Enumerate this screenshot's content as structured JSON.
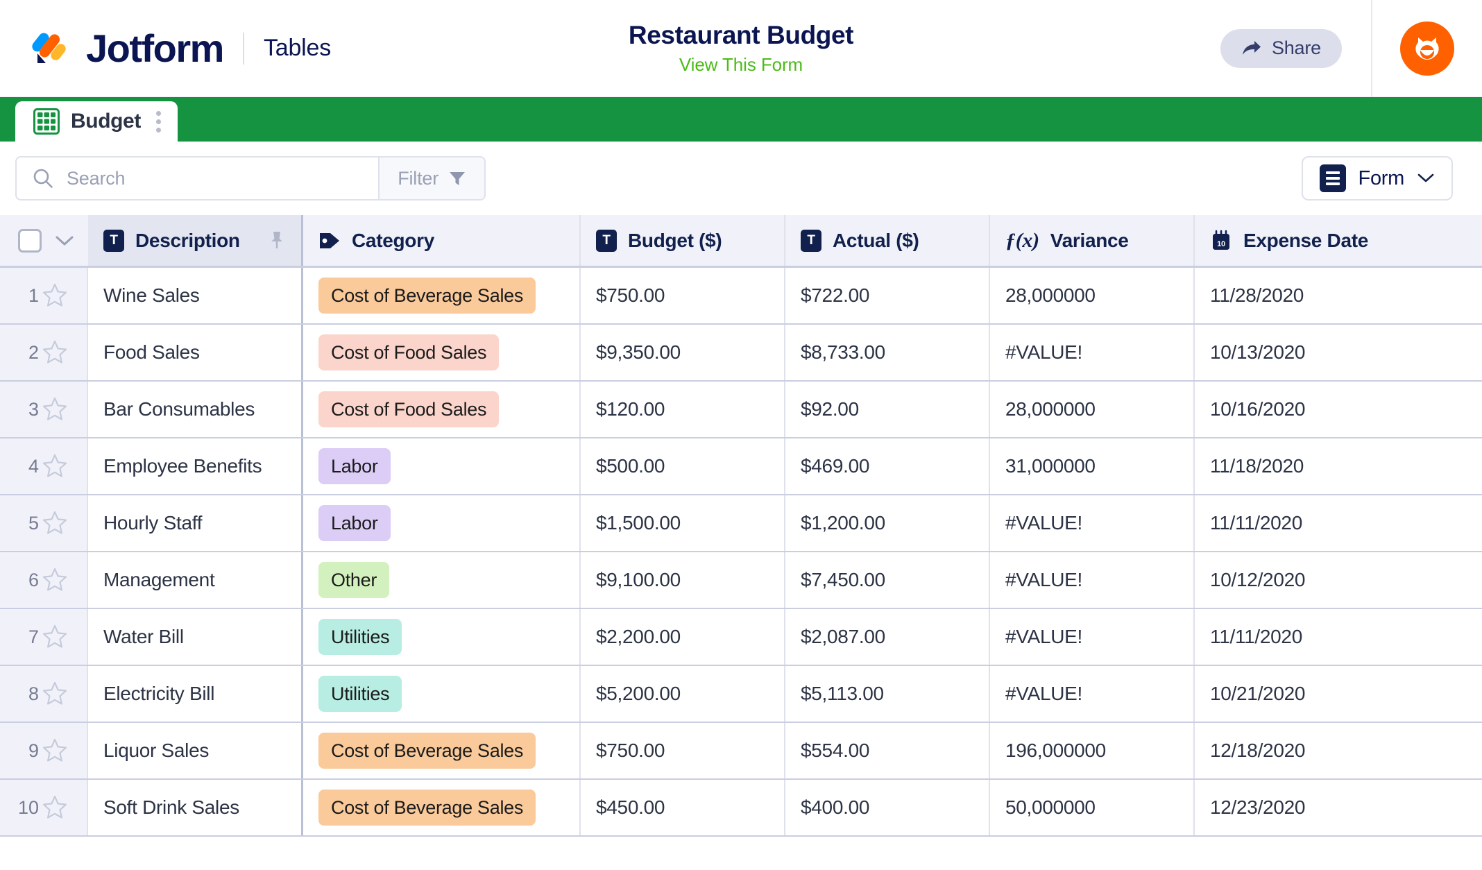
{
  "header": {
    "brand_name": "Jotform",
    "product_label": "Tables",
    "form_title": "Restaurant Budget",
    "view_form_link": "View This Form",
    "share_label": "Share",
    "brand_navy": "#0A1551",
    "link_green": "#4CBB17",
    "avatar_color": "#FF6100"
  },
  "tabs": {
    "active_tab_label": "Budget",
    "strip_color": "#159340"
  },
  "toolbar": {
    "search_placeholder": "Search",
    "search_value": "",
    "filter_label": "Filter",
    "view_label": "Form"
  },
  "table": {
    "columns": [
      {
        "label": "Description",
        "icon": "text-field-icon",
        "pinned": true
      },
      {
        "label": "Category",
        "icon": "tag-icon",
        "pinned": false
      },
      {
        "label": "Budget ($)",
        "icon": "text-field-icon",
        "pinned": false
      },
      {
        "label": "Actual ($)",
        "icon": "text-field-icon",
        "pinned": false
      },
      {
        "label": "Variance",
        "icon": "formula-icon",
        "pinned": false
      },
      {
        "label": "Expense Date",
        "icon": "calendar-icon",
        "pinned": false
      }
    ],
    "calendar_icon_day": "10",
    "category_colors": {
      "Cost of Beverage Sales": "#FACA9A",
      "Cost of Food Sales": "#FBD5CB",
      "Labor": "#DCCDF7",
      "Other": "#D3F1BE",
      "Utilities": "#B7EDE2"
    },
    "rows": [
      {
        "num": "1",
        "description": "Wine Sales",
        "category": "Cost of Beverage Sales",
        "budget": "$750.00",
        "actual": "$722.00",
        "variance": "28,000000",
        "date": "11/28/2020"
      },
      {
        "num": "2",
        "description": "Food Sales",
        "category": "Cost of Food Sales",
        "budget": "$9,350.00",
        "actual": "$8,733.00",
        "variance": "#VALUE!",
        "date": "10/13/2020"
      },
      {
        "num": "3",
        "description": "Bar Consumables",
        "category": "Cost of Food Sales",
        "budget": "$120.00",
        "actual": "$92.00",
        "variance": "28,000000",
        "date": "10/16/2020"
      },
      {
        "num": "4",
        "description": "Employee Benefits",
        "category": "Labor",
        "budget": "$500.00",
        "actual": "$469.00",
        "variance": "31,000000",
        "date": "11/18/2020"
      },
      {
        "num": "5",
        "description": "Hourly Staff",
        "category": "Labor",
        "budget": "$1,500.00",
        "actual": "$1,200.00",
        "variance": "#VALUE!",
        "date": "11/11/2020"
      },
      {
        "num": "6",
        "description": "Management",
        "category": "Other",
        "budget": "$9,100.00",
        "actual": "$7,450.00",
        "variance": "#VALUE!",
        "date": "10/12/2020"
      },
      {
        "num": "7",
        "description": "Water Bill",
        "category": "Utilities",
        "budget": "$2,200.00",
        "actual": "$2,087.00",
        "variance": "#VALUE!",
        "date": "11/11/2020"
      },
      {
        "num": "8",
        "description": "Electricity Bill",
        "category": "Utilities",
        "budget": "$5,200.00",
        "actual": "$5,113.00",
        "variance": "#VALUE!",
        "date": "10/21/2020"
      },
      {
        "num": "9",
        "description": "Liquor Sales",
        "category": "Cost of Beverage Sales",
        "budget": "$750.00",
        "actual": "$554.00",
        "variance": "196,000000",
        "date": "12/18/2020"
      },
      {
        "num": "10",
        "description": "Soft Drink Sales",
        "category": "Cost of Beverage Sales",
        "budget": "$450.00",
        "actual": "$400.00",
        "variance": "50,000000",
        "date": "12/23/2020"
      }
    ]
  }
}
